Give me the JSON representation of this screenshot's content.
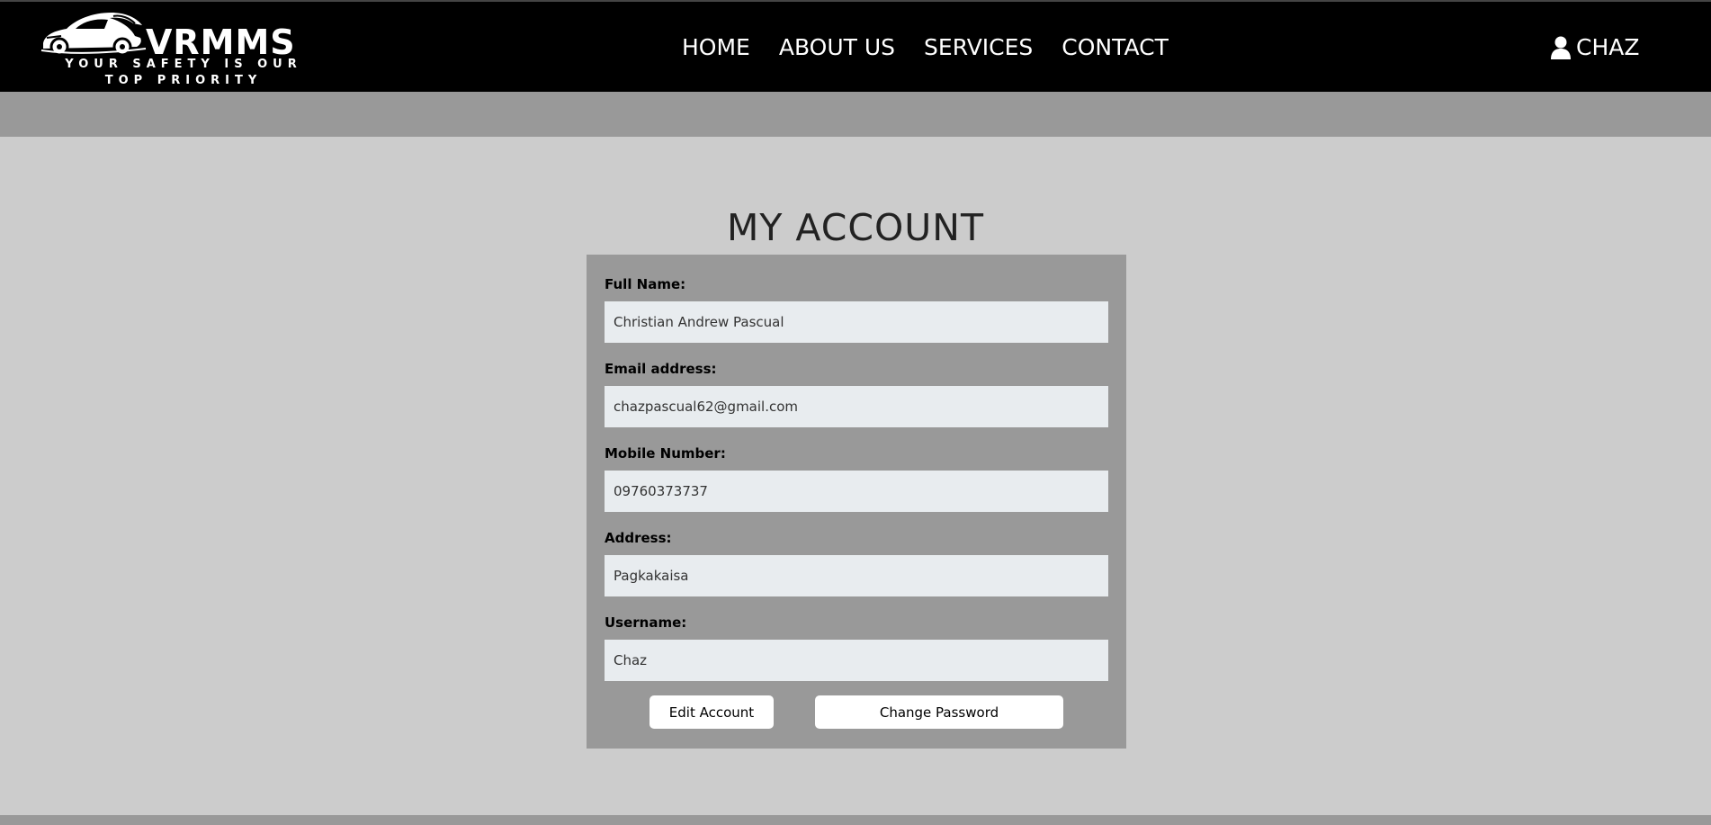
{
  "brand": {
    "name": "VRMMS",
    "tagline_line1": "YOUR SAFETY IS OUR",
    "tagline_line2": "TOP PRIORITY"
  },
  "nav": {
    "items": [
      {
        "label": "HOME"
      },
      {
        "label": "ABOUT US"
      },
      {
        "label": "SERVICES"
      },
      {
        "label": "CONTACT"
      }
    ]
  },
  "user": {
    "name": "CHAZ",
    "icon": "user-icon"
  },
  "page": {
    "title": "MY ACCOUNT"
  },
  "form": {
    "fields": [
      {
        "label": "Full Name:",
        "value": "Christian Andrew Pascual"
      },
      {
        "label": "Email address:",
        "value": "chazpascual62@gmail.com"
      },
      {
        "label": "Mobile Number:",
        "value": "09760373737"
      },
      {
        "label": "Address:",
        "value": "Pagkakaisa"
      },
      {
        "label": "Username:",
        "value": "Chaz"
      }
    ],
    "edit_label": "Edit Account",
    "change_password_label": "Change Password"
  },
  "colors": {
    "navbar": "#000000",
    "band": "#999999",
    "page_bg": "#cccccc",
    "card_bg": "#999999",
    "input_bg": "#e8ecef"
  }
}
